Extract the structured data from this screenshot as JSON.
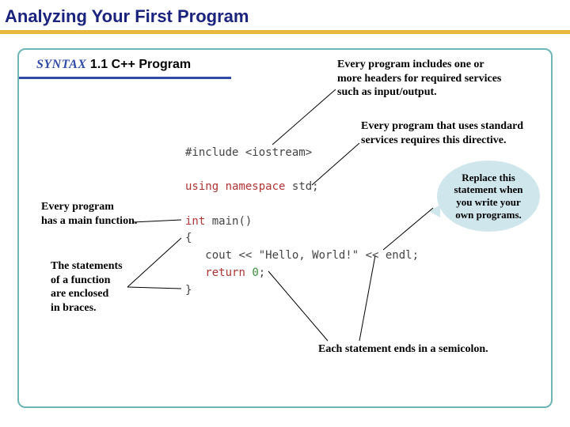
{
  "page": {
    "title": "Analyzing Your First Program"
  },
  "header": {
    "syntax_label": "SYNTAX",
    "syntax_number": "1.1",
    "syntax_title": "C++ Program"
  },
  "code": {
    "include": "#include <iostream>",
    "using_kw": "using",
    "namespace_kw": "namespace",
    "std_stmt": "std;",
    "int_kw": "int",
    "main_decl": "main()",
    "brace_open": "{",
    "indent": "   ",
    "cout_stmt": "cout << \"Hello, World!\" << endl;",
    "return_kw": "return",
    "return_val": "0",
    "return_semi": ";",
    "brace_close": "}"
  },
  "annotations": {
    "headers": "Every program includes one or\nmore headers for required services\nsuch as input/output.",
    "directive": "Every program that uses standard\nservices requires this directive.",
    "callout": "Replace this statement when you write your own programs.",
    "main": "Every program\nhas a main function.",
    "braces": "The statements\nof a function\nare enclosed\nin braces.",
    "semicolon": "Each statement ends in a semicolon."
  }
}
